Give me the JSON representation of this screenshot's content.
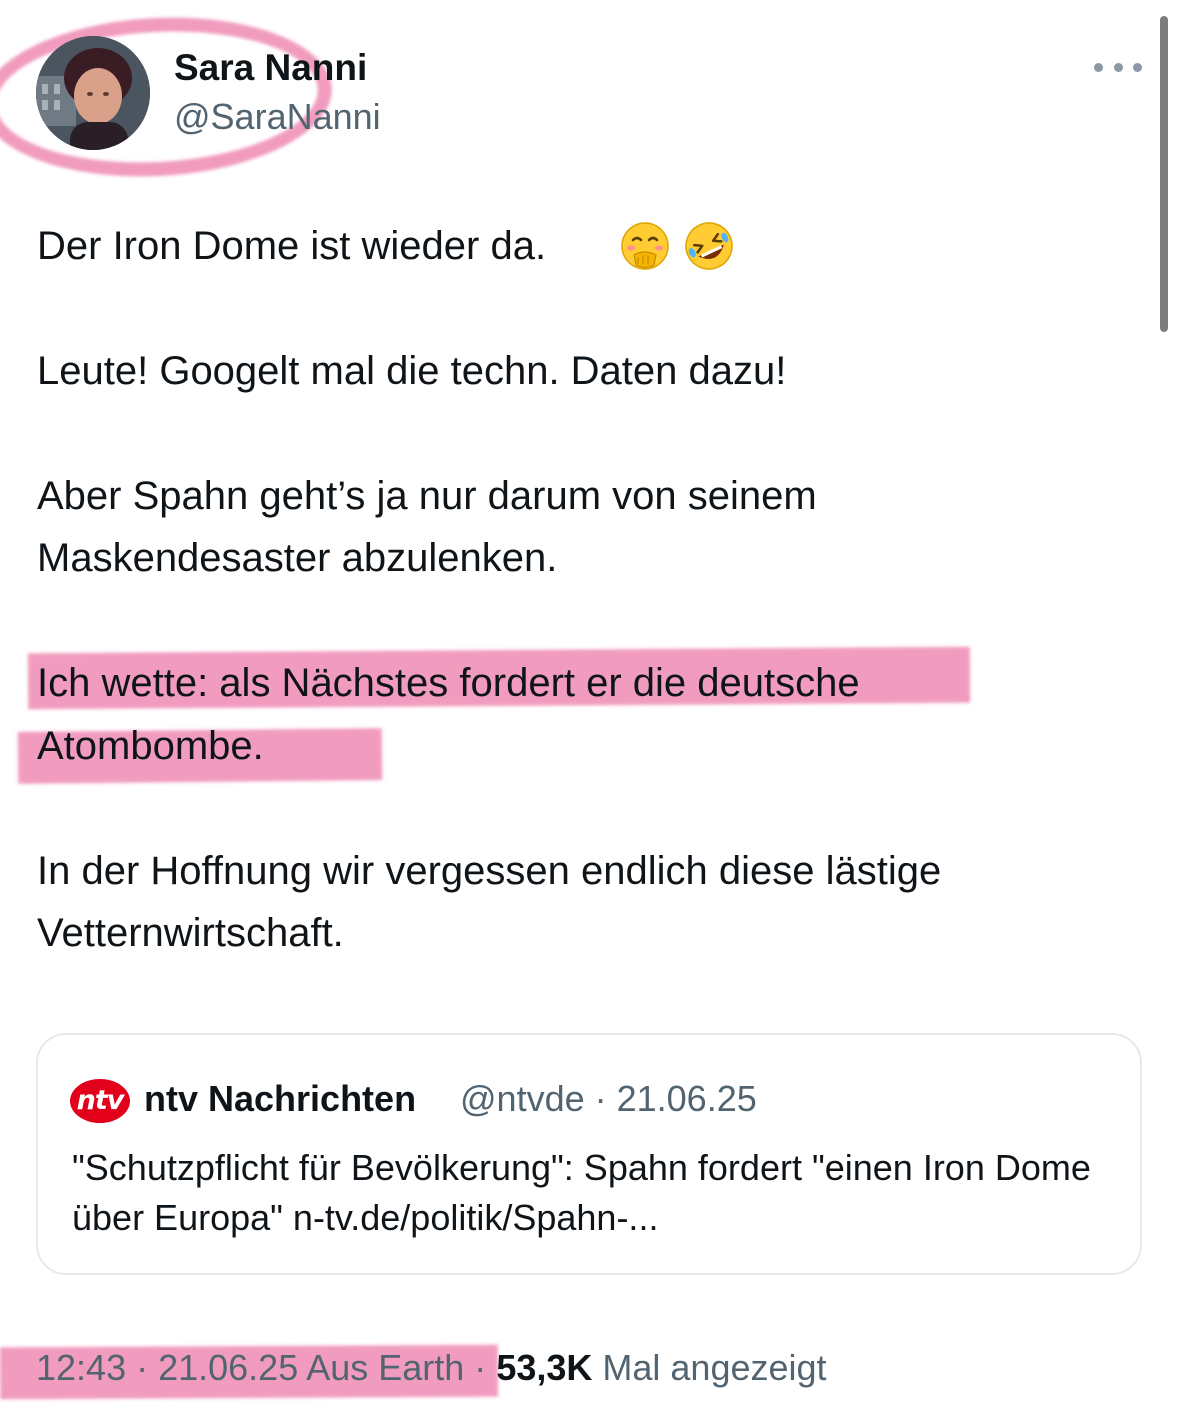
{
  "author": {
    "display_name": "Sara Nanni",
    "handle": "@SaraNanni"
  },
  "tweet": {
    "lines": [
      "Der Iron Dome ist wieder da.",
      "Leute! Googelt mal die techn. Daten dazu!",
      "Aber Spahn geht’s ja nur darum von seinem",
      "Maskendesaster abzulenken.",
      "Ich wette: als Nächstes fordert er die deutsche",
      "Atombombe.",
      "In der Hoffnung wir vergessen endlich diese lästige",
      "Vetternwirtschaft."
    ],
    "emojis": [
      "face-with-hand-over-mouth-icon",
      "rolling-on-the-floor-laughing-icon"
    ]
  },
  "quote": {
    "logo_text": "ntv",
    "name": "ntv Nachrichten",
    "meta": "@ntvde · 21.06.25",
    "text": "\"Schutzpflicht für Bevölkerung\": Spahn fordert \"einen Iron Dome über Europa\" n-tv.de/politik/Spahn-..."
  },
  "footer": {
    "time_date_location": "12:43 · 21.06.25 Aus Earth · ",
    "views": "53,3K",
    "views_label": " Mal angezeigt"
  },
  "colors": {
    "highlighter": "#e86096",
    "secondary_text": "#536471",
    "ntv_red": "#e2001a"
  }
}
